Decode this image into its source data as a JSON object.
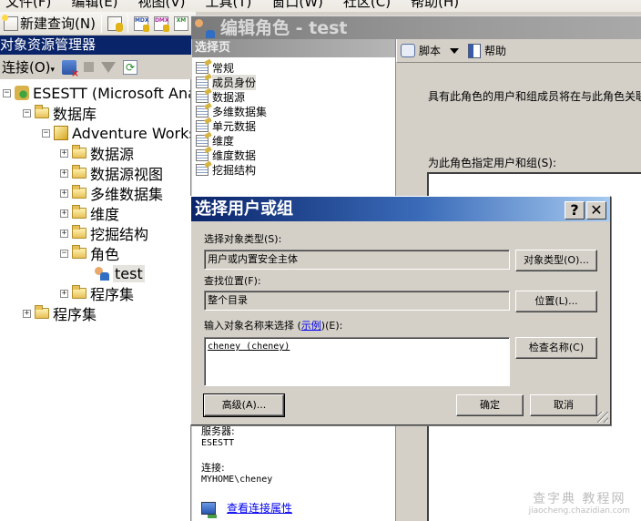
{
  "menubar": [
    "文件(F)",
    "编辑(E)",
    "视图(V)",
    "工具(T)",
    "窗口(W)",
    "社区(C)",
    "帮助(H)"
  ],
  "toolbar": {
    "new_query_label": "新建查询(N)",
    "icons": [
      "new-query-icon",
      "database-engine-query-icon",
      "mdx-query-icon",
      "dmx-query-icon",
      "xmla-query-icon"
    ],
    "mdx": "MDX",
    "dmx": "DMX",
    "xmla": "XM"
  },
  "object_explorer": {
    "title": "对象资源管理器",
    "connect_label": "连接(O)",
    "tree": {
      "server": "ESESTT (Microsoft Anal",
      "databases": "数据库",
      "database": "Adventure Works",
      "children": [
        "数据源",
        "数据源视图",
        "多维数据集",
        "维度",
        "挖掘结构",
        "角色",
        "程序集"
      ],
      "role_item": "test",
      "server_assemblies": "程序集"
    }
  },
  "edit_role": {
    "title": "编辑角色 - test",
    "select_page_header": "选择页",
    "pages": [
      "常规",
      "成员身份",
      "数据源",
      "多维数据集",
      "单元数据",
      "维度",
      "维度数据",
      "挖掘结构"
    ],
    "selected_page": "成员身份",
    "script_label": "脚本",
    "help_label": "帮助",
    "description": "具有此角色的用户和组成员将在与此角色关联",
    "assign_label": "为此角色指定用户和组(S):",
    "connection": {
      "server_label": "服务器:",
      "server_value": "ESESTT",
      "connection_label": "连接:",
      "connection_value": "MYHOME\\cheney",
      "view_properties_link": "查看连接属性"
    }
  },
  "select_users_dialog": {
    "title": "选择用户或组",
    "help_button": "?",
    "close_button": "✕",
    "object_type_label": "选择对象类型(S):",
    "object_type_value": "用户或内置安全主体",
    "object_types_button": "对象类型(O)...",
    "location_label": "查找位置(F):",
    "location_value": "整个目录",
    "locations_button": "位置(L)...",
    "names_label_prefix": "输入对象名称来选择 (",
    "names_label_link": "示例",
    "names_label_suffix": ")(E):",
    "names_value": "cheney (cheney)",
    "check_names_button": "检查名称(C)",
    "advanced_button": "高级(A)...",
    "ok_button": "确定",
    "cancel_button": "取消"
  },
  "watermark": {
    "line1": "查字典 教程网",
    "line2": "jiaocheng.chazidian.com"
  }
}
